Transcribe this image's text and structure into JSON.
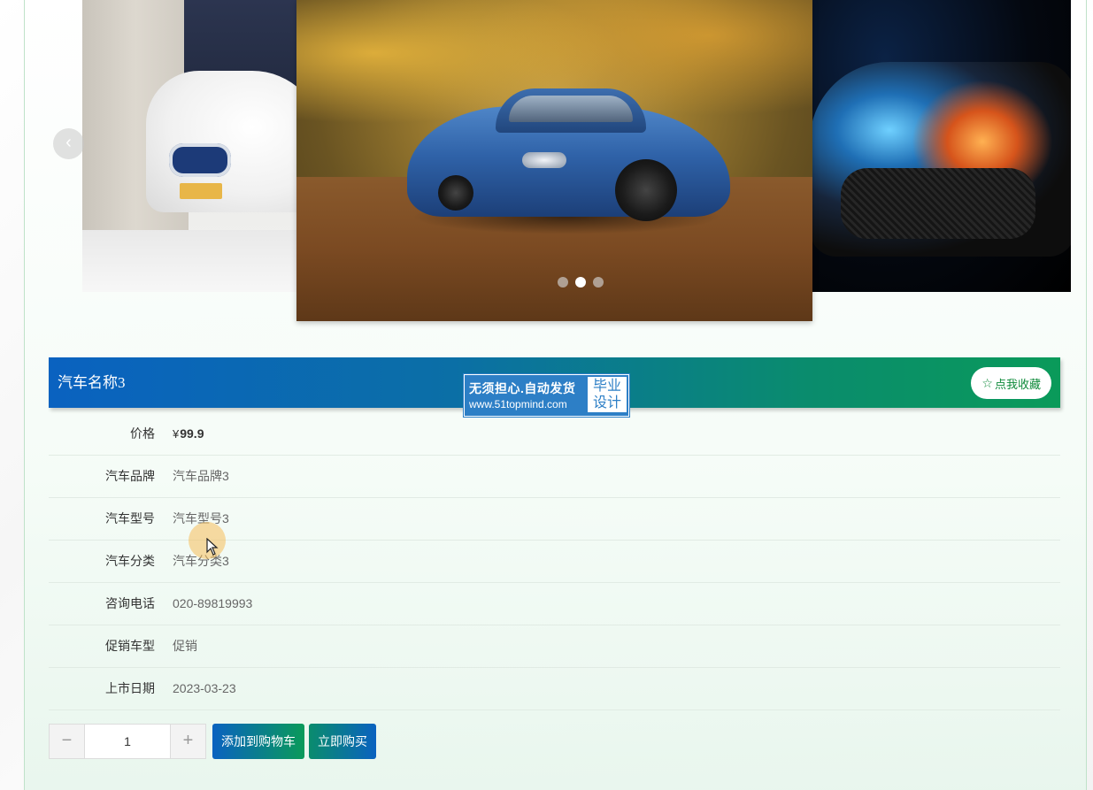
{
  "carousel": {
    "prev_label": "‹",
    "active_index": 1,
    "dot_count": 3
  },
  "product": {
    "title": "汽车名称3",
    "favorite_label": "点我收藏",
    "favorite_icon": "star-outline-icon"
  },
  "watermark": {
    "line1": "无须担心.自动发货",
    "line2": "www.51topmind.com",
    "badge_top": "毕业",
    "badge_bottom": "设计"
  },
  "details": {
    "price": {
      "label": "价格",
      "currency": "¥",
      "value": "99.9"
    },
    "brand": {
      "label": "汽车品牌",
      "value": "汽车品牌3"
    },
    "model": {
      "label": "汽车型号",
      "value": "汽车型号3"
    },
    "category": {
      "label": "汽车分类",
      "value": "汽车分类3"
    },
    "phone": {
      "label": "咨询电话",
      "value": "020-89819993"
    },
    "promo": {
      "label": "促销车型",
      "value": "促销"
    },
    "release": {
      "label": "上市日期",
      "value": "2023-03-23"
    }
  },
  "purchase": {
    "minus_label": "−",
    "plus_label": "+",
    "quantity": "1",
    "add_to_cart_label": "添加到购物车",
    "buy_now_label": "立即购买"
  },
  "colors": {
    "brand_blue": "#0a62c0",
    "brand_green": "#0a9a5a",
    "favorite_text": "#0e8a3a"
  }
}
